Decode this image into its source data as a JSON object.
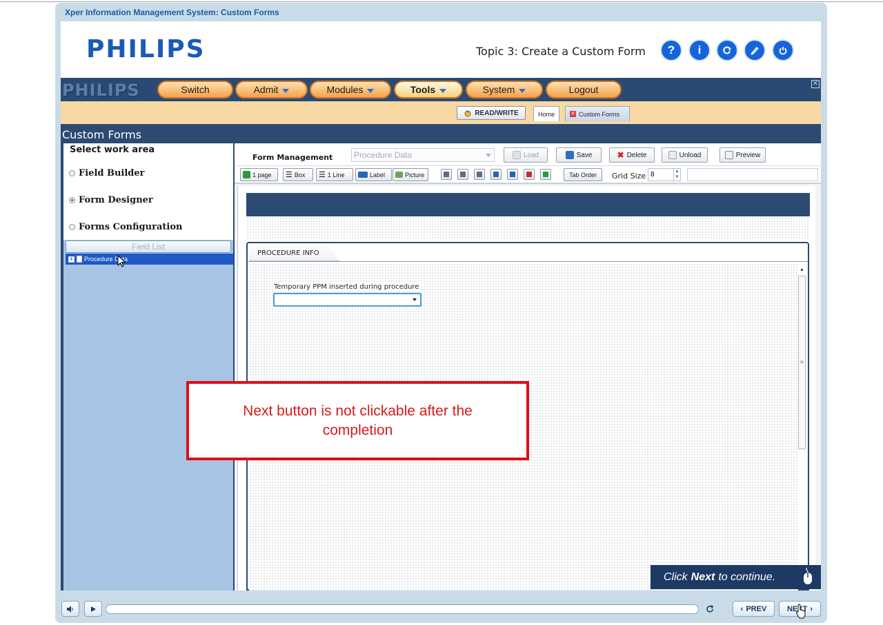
{
  "frame": {
    "title": "Xper Information Management System: Custom Forms"
  },
  "course_header": {
    "logo": "PHILIPS",
    "topic_title": "Topic 3: Create a Custom Form",
    "buttons": [
      {
        "name": "help-button",
        "glyph": "?",
        "icon": "help-icon"
      },
      {
        "name": "info-button",
        "glyph": "i",
        "icon": "info-icon"
      },
      {
        "name": "replay-button",
        "glyph": "c",
        "icon": "replay-icon"
      },
      {
        "name": "pen-button",
        "glyph": "∕",
        "icon": "pen-icon"
      },
      {
        "name": "power-button",
        "glyph": "⏻",
        "icon": "power-icon"
      }
    ]
  },
  "app": {
    "logo": "PHILIPS",
    "menu": [
      {
        "label": "Switch",
        "dropdown": false
      },
      {
        "label": "Admit",
        "dropdown": true
      },
      {
        "label": "Modules",
        "dropdown": true
      },
      {
        "label": "Tools",
        "dropdown": true,
        "active": true
      },
      {
        "label": "System",
        "dropdown": true
      },
      {
        "label": "Logout",
        "dropdown": false
      }
    ],
    "read_write": "READ/WRITE",
    "tabs": [
      {
        "label": "Home"
      },
      {
        "label": "Custom Forms"
      }
    ],
    "section_title": "Custom Forms"
  },
  "left_panel": {
    "heading": "Select work area",
    "options": [
      {
        "label": "Field Builder",
        "checked": false
      },
      {
        "label": "Form Designer",
        "checked": true
      },
      {
        "label": "Forms Configuration",
        "checked": false
      }
    ],
    "field_list_button": "Field List",
    "tree_item": "Procedure Data"
  },
  "toolbar": {
    "form_management_label": "Form Management",
    "form_select_value": "Procedure Data",
    "load": "Load",
    "save": "Save",
    "delete": "Delete",
    "unload": "Unload",
    "preview": "Preview",
    "one_page": "1 page",
    "box": "Box",
    "one_line": "1 Line",
    "label": "Label",
    "picture": "Picture",
    "tab_order": "Tab Order",
    "grid_size_label": "Grid Size",
    "grid_size_value": "8"
  },
  "canvas": {
    "tab_label": "PROCEDURE INFO",
    "field_label": "Temporary PPM inserted during procedure"
  },
  "callout": {
    "text": "Next button is not clickable after the completion"
  },
  "overlay": {
    "click_prefix": "Click",
    "click_bold": "Next",
    "click_suffix": "to continue."
  },
  "player": {
    "prev": "PREV",
    "next": "NEXT"
  }
}
